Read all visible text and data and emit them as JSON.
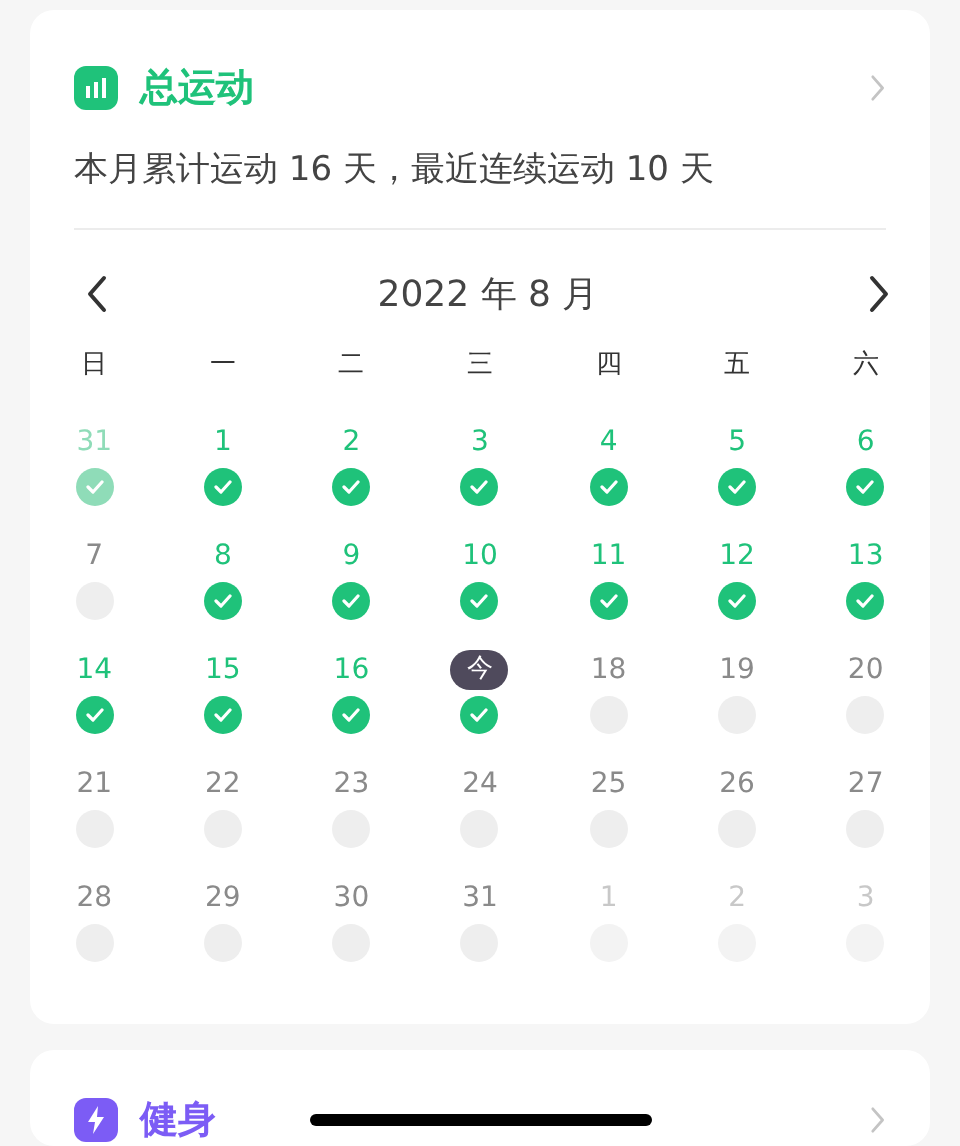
{
  "summary_card": {
    "title": "总运动",
    "summary": "本月累计运动 16 天，最近连续运动 10 天"
  },
  "calendar": {
    "month_label": "2022 年 8 月",
    "weekdays": [
      "日",
      "一",
      "二",
      "三",
      "四",
      "五",
      "六"
    ],
    "days": [
      {
        "label": "31",
        "done": true,
        "other_month": true,
        "today": false
      },
      {
        "label": "1",
        "done": true,
        "other_month": false,
        "today": false
      },
      {
        "label": "2",
        "done": true,
        "other_month": false,
        "today": false
      },
      {
        "label": "3",
        "done": true,
        "other_month": false,
        "today": false
      },
      {
        "label": "4",
        "done": true,
        "other_month": false,
        "today": false
      },
      {
        "label": "5",
        "done": true,
        "other_month": false,
        "today": false
      },
      {
        "label": "6",
        "done": true,
        "other_month": false,
        "today": false
      },
      {
        "label": "7",
        "done": false,
        "other_month": false,
        "today": false
      },
      {
        "label": "8",
        "done": true,
        "other_month": false,
        "today": false
      },
      {
        "label": "9",
        "done": true,
        "other_month": false,
        "today": false
      },
      {
        "label": "10",
        "done": true,
        "other_month": false,
        "today": false
      },
      {
        "label": "11",
        "done": true,
        "other_month": false,
        "today": false
      },
      {
        "label": "12",
        "done": true,
        "other_month": false,
        "today": false
      },
      {
        "label": "13",
        "done": true,
        "other_month": false,
        "today": false
      },
      {
        "label": "14",
        "done": true,
        "other_month": false,
        "today": false
      },
      {
        "label": "15",
        "done": true,
        "other_month": false,
        "today": false
      },
      {
        "label": "16",
        "done": true,
        "other_month": false,
        "today": false
      },
      {
        "label": "今",
        "done": true,
        "other_month": false,
        "today": true
      },
      {
        "label": "18",
        "done": false,
        "other_month": false,
        "today": false
      },
      {
        "label": "19",
        "done": false,
        "other_month": false,
        "today": false
      },
      {
        "label": "20",
        "done": false,
        "other_month": false,
        "today": false
      },
      {
        "label": "21",
        "done": false,
        "other_month": false,
        "today": false
      },
      {
        "label": "22",
        "done": false,
        "other_month": false,
        "today": false
      },
      {
        "label": "23",
        "done": false,
        "other_month": false,
        "today": false
      },
      {
        "label": "24",
        "done": false,
        "other_month": false,
        "today": false
      },
      {
        "label": "25",
        "done": false,
        "other_month": false,
        "today": false
      },
      {
        "label": "26",
        "done": false,
        "other_month": false,
        "today": false
      },
      {
        "label": "27",
        "done": false,
        "other_month": false,
        "today": false
      },
      {
        "label": "28",
        "done": false,
        "other_month": false,
        "today": false
      },
      {
        "label": "29",
        "done": false,
        "other_month": false,
        "today": false
      },
      {
        "label": "30",
        "done": false,
        "other_month": false,
        "today": false
      },
      {
        "label": "31",
        "done": false,
        "other_month": false,
        "today": false
      },
      {
        "label": "1",
        "done": false,
        "other_month": true,
        "today": false
      },
      {
        "label": "2",
        "done": false,
        "other_month": true,
        "today": false
      },
      {
        "label": "3",
        "done": false,
        "other_month": true,
        "today": false
      }
    ]
  },
  "fitness_card": {
    "title": "健身"
  }
}
